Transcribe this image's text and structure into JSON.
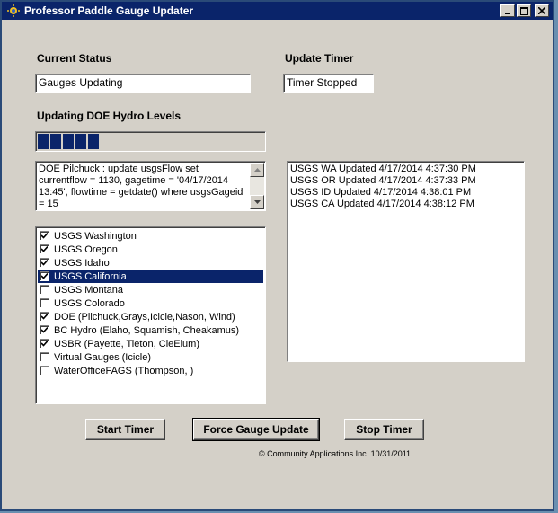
{
  "window": {
    "title": "Professor Paddle Gauge Updater"
  },
  "status": {
    "label": "Current Status",
    "value": "Gauges Updating"
  },
  "timer": {
    "label": "Update Timer",
    "value": "Timer Stopped"
  },
  "progress": {
    "label": "Updating DOE Hydro Levels",
    "blocks": 5,
    "fraction": 0.28
  },
  "sql": {
    "text": "DOE Pilchuck : update usgsFlow set currentflow =  1130, gagetime = '04/17/2014   13:45', flowtime = getdate() where usgsGageid = 15"
  },
  "sources": [
    {
      "label": "USGS Washington",
      "checked": true,
      "selected": false
    },
    {
      "label": "USGS Oregon",
      "checked": true,
      "selected": false
    },
    {
      "label": "USGS Idaho",
      "checked": true,
      "selected": false
    },
    {
      "label": "USGS California",
      "checked": true,
      "selected": true
    },
    {
      "label": "USGS Montana",
      "checked": false,
      "selected": false
    },
    {
      "label": "USGS Colorado",
      "checked": false,
      "selected": false
    },
    {
      "label": "DOE (Pilchuck,Grays,Icicle,Nason, Wind)",
      "checked": true,
      "selected": false
    },
    {
      "label": "BC Hydro (Elaho, Squamish, Cheakamus)",
      "checked": true,
      "selected": false
    },
    {
      "label": "USBR (Payette, Tieton, CleElum)",
      "checked": true,
      "selected": false
    },
    {
      "label": "Virtual Gauges (Icicle)",
      "checked": false,
      "selected": false
    },
    {
      "label": "WaterOfficeFAGS (Thompson, )",
      "checked": false,
      "selected": false
    }
  ],
  "log": [
    "USGS WA Updated 4/17/2014 4:37:30 PM",
    "USGS OR Updated 4/17/2014 4:37:33 PM",
    "USGS ID Updated 4/17/2014 4:38:01 PM",
    "USGS CA Updated 4/17/2014 4:38:12 PM"
  ],
  "buttons": {
    "start": "Start Timer",
    "force": "Force Gauge Update",
    "stop": "Stop Timer"
  },
  "footer": "© Community Applications Inc. 10/31/2011",
  "colors": {
    "titlebar": "#0a246a",
    "face": "#d4d0c8",
    "selection": "#0a246a"
  }
}
